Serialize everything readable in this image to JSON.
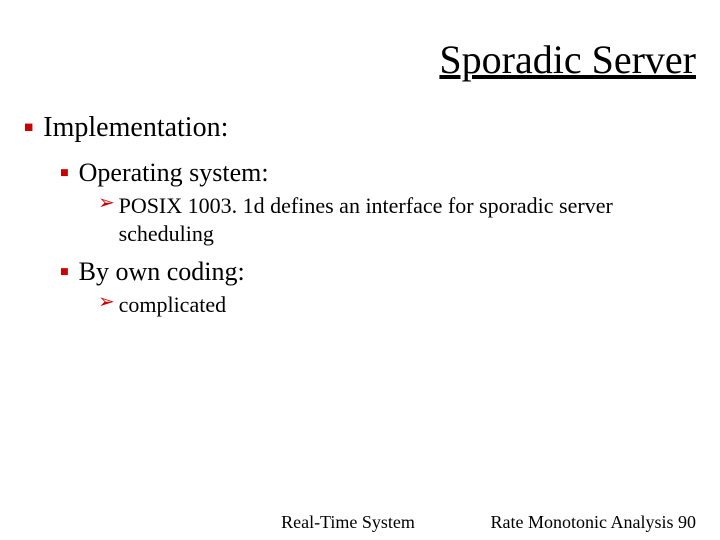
{
  "title": "Sporadic Server",
  "body": {
    "h1": "Implementation:",
    "sec1": {
      "heading": "Operating system:",
      "item": "POSIX 1003. 1d defines an interface for sporadic server scheduling"
    },
    "sec2": {
      "heading": "By own coding:",
      "item": "complicated"
    }
  },
  "footer": {
    "center": "Real-Time System",
    "right_label": "Rate Monotonic Analysis",
    "page": "90"
  }
}
